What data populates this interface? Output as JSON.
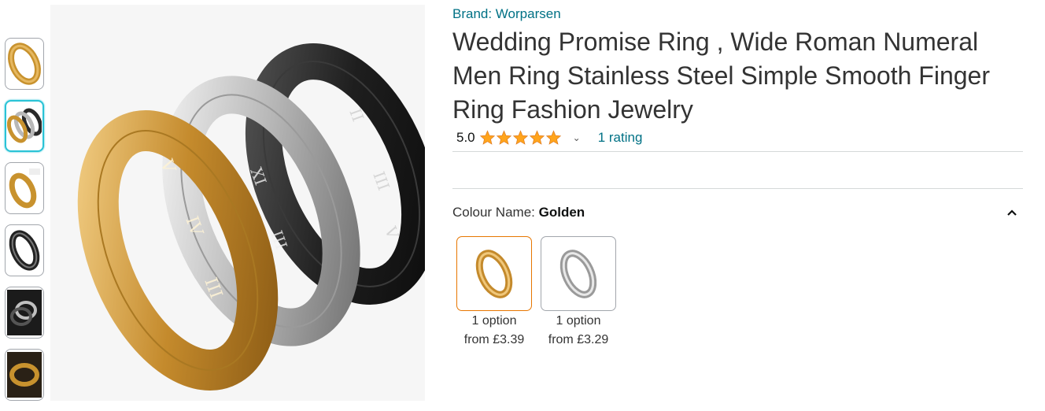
{
  "product": {
    "brand": "Brand: Worparsen",
    "title": "Wedding Promise Ring , Wide Roman Numeral Men Ring Stainless Steel Simple Smooth Finger Ring Fashion Jewelry",
    "rating_value": "5.0",
    "rating_stars": 5,
    "rating_link": "1 rating"
  },
  "variation": {
    "label": "Colour Name: ",
    "selected": "Golden",
    "options": [
      {
        "option_count": "1 option",
        "price": "from £3.39",
        "color": "gold",
        "selected": true
      },
      {
        "option_count": "1 option",
        "price": "from £3.29",
        "color": "silver",
        "selected": false
      }
    ]
  },
  "gallery": {
    "thumbnails": [
      "gold-ring",
      "three-rings",
      "gold-ring-detail",
      "black-ring",
      "black-silver-ring",
      "gold-ring-dark"
    ],
    "selected_index": 1,
    "icons": {
      "share": "share-icon",
      "collapse": "chevron-up-icon",
      "rating_dropdown": "chevron-down-icon"
    }
  },
  "colors": {
    "link": "#007185",
    "star": "#ffa41c",
    "selected_thumb": "#2ac3d6",
    "selected_swatch": "#e77600"
  }
}
